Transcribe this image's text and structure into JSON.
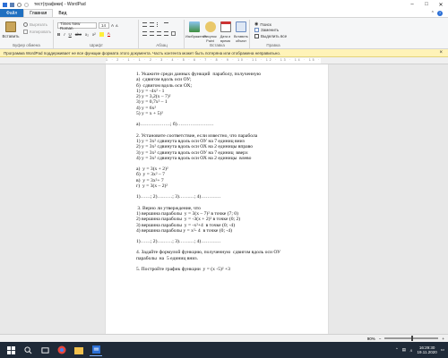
{
  "window": {
    "title": "тест(графики) - WordPad"
  },
  "tabs": {
    "file": "Файл",
    "home": "Главная",
    "view": "Вид"
  },
  "ribbon": {
    "paste_label": "Вставить",
    "cut_label": "Вырезать",
    "copy_label": "Копировать",
    "clipboard_group": "Буфер обмена",
    "font_name": "Times New Roman",
    "font_size": "14",
    "font_group": "Шрифт",
    "paragraph_group": "Абзац",
    "image_label": "Изображение",
    "paint_label": "Рисунок Paint",
    "datetime_label": "Дата и время",
    "object_label": "Вставить объект",
    "insert_group": "Вставка",
    "find_label": "Поиск",
    "replace_label": "Заменить",
    "select_all_label": "Выделить все",
    "edit_group": "Правка"
  },
  "notice": "Программа WordPad поддерживает не все функции формата этого документа. Часть контента может быть потеряна или отображена неправильно.",
  "ruler": "1 · 2 · 1 · 1 · 2 · 3 · 4 · 5 · 6 · 7 · 8 · 9 · 10 · 11 · 12 · 13 · 14 · 15 · 16 · 17",
  "document": {
    "lines": [
      "1. Укажите среди данных функций  параболу, полученную",
      "а)  сдвигом вдоль оси ОУ;",
      "б)  сдвигом вдоль оси ОХ;",
      "1) y = -4x² - 1",
      "2) y = 3,2(x – 7)²",
      "3) y = 0,7x² – 1",
      "4) y = 6x²",
      "5) y = x + 5)²",
      "",
      "а)………………; б)………………….",
      "",
      "2. Установите соответствие, если известно, что парабола",
      "1) y = 3x² сдвинута вдоль оси ОУ на 7 единиц вниз",
      "2) y = 3x² сдвинута вдоль оси ОХ на 2 единицы вправо",
      "3) y = 3x² сдвинута вдоль оси ОУ на 7 единиц  вверх",
      "4) y = 3x² сдвинута вдоль оси ОХ на 2 единицы  влево",
      "",
      "а)  y = 3(x + 2)²",
      "б)  y = 3x² – 7",
      "в)  y = 3x²+ 7",
      "г)  y = 3(x – 2)²",
      "",
      "1)……; 2)………; 3)………; 4)…………",
      "",
      " 3. Верно ли утверждение, что",
      "1) вершина параболы  y = 3(x – 7)² в точке (7; 0)",
      "2) вершина параболы  y = -3(x + 2)² в точке (0; 2)",
      "3) вершина параболы  y = -x²+4  в точке (0; -4)",
      "4) вершина параболы y = x²- 4  в точке (0; -4)",
      "",
      "1)……; 2)………; 3)………; 4)…………",
      "",
      "4. Задайте формулой функцию, полученную  сдвигом вдоль оси ОУ",
      "параболы  на  5 единиц вниз.",
      "",
      "5. Постройте график функции  y = (x -5)² +3"
    ]
  },
  "status": {
    "zoom": "90%"
  },
  "taskbar": {
    "time": "16:29:30",
    "date": "19.11.2020"
  },
  "colors": {
    "file_tab": "#1e6fc0",
    "notice_bg": "#fff3b8",
    "taskbar_bg": "#1f2a38"
  }
}
